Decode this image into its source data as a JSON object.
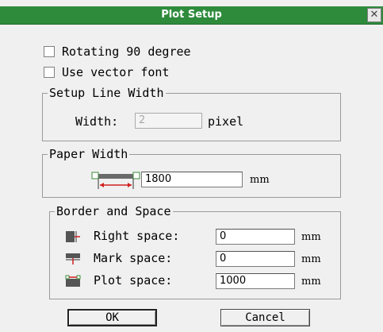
{
  "dialog": {
    "title": "Plot Setup",
    "close_glyph": "✕"
  },
  "options": {
    "rotating": {
      "label": "Rotating 90 degree",
      "checked": false
    },
    "vector_font": {
      "label": "Use vector font",
      "checked": false
    }
  },
  "line_width": {
    "legend": "Setup Line Width",
    "label": "Width:",
    "value": "2",
    "unit": "pixel"
  },
  "paper_width": {
    "legend": "Paper Width",
    "value": "1800",
    "unit": "mm"
  },
  "border_space": {
    "legend": "Border and Space",
    "right": {
      "label": "Right space:",
      "value": "0",
      "unit": "mm"
    },
    "mark": {
      "label": "Mark space:",
      "value": "0",
      "unit": "mm"
    },
    "plot": {
      "label": "Plot space:",
      "value": "1000",
      "unit": "mm"
    }
  },
  "buttons": {
    "ok": "OK",
    "cancel": "Cancel"
  },
  "colors": {
    "titlebar": "#2e8b3c",
    "dialog_bg": "#f0f0f0",
    "disabled_text": "#a8a8a8"
  },
  "icons": [
    "paper-width-icon",
    "right-space-icon",
    "mark-space-icon",
    "plot-space-icon",
    "close-icon"
  ]
}
